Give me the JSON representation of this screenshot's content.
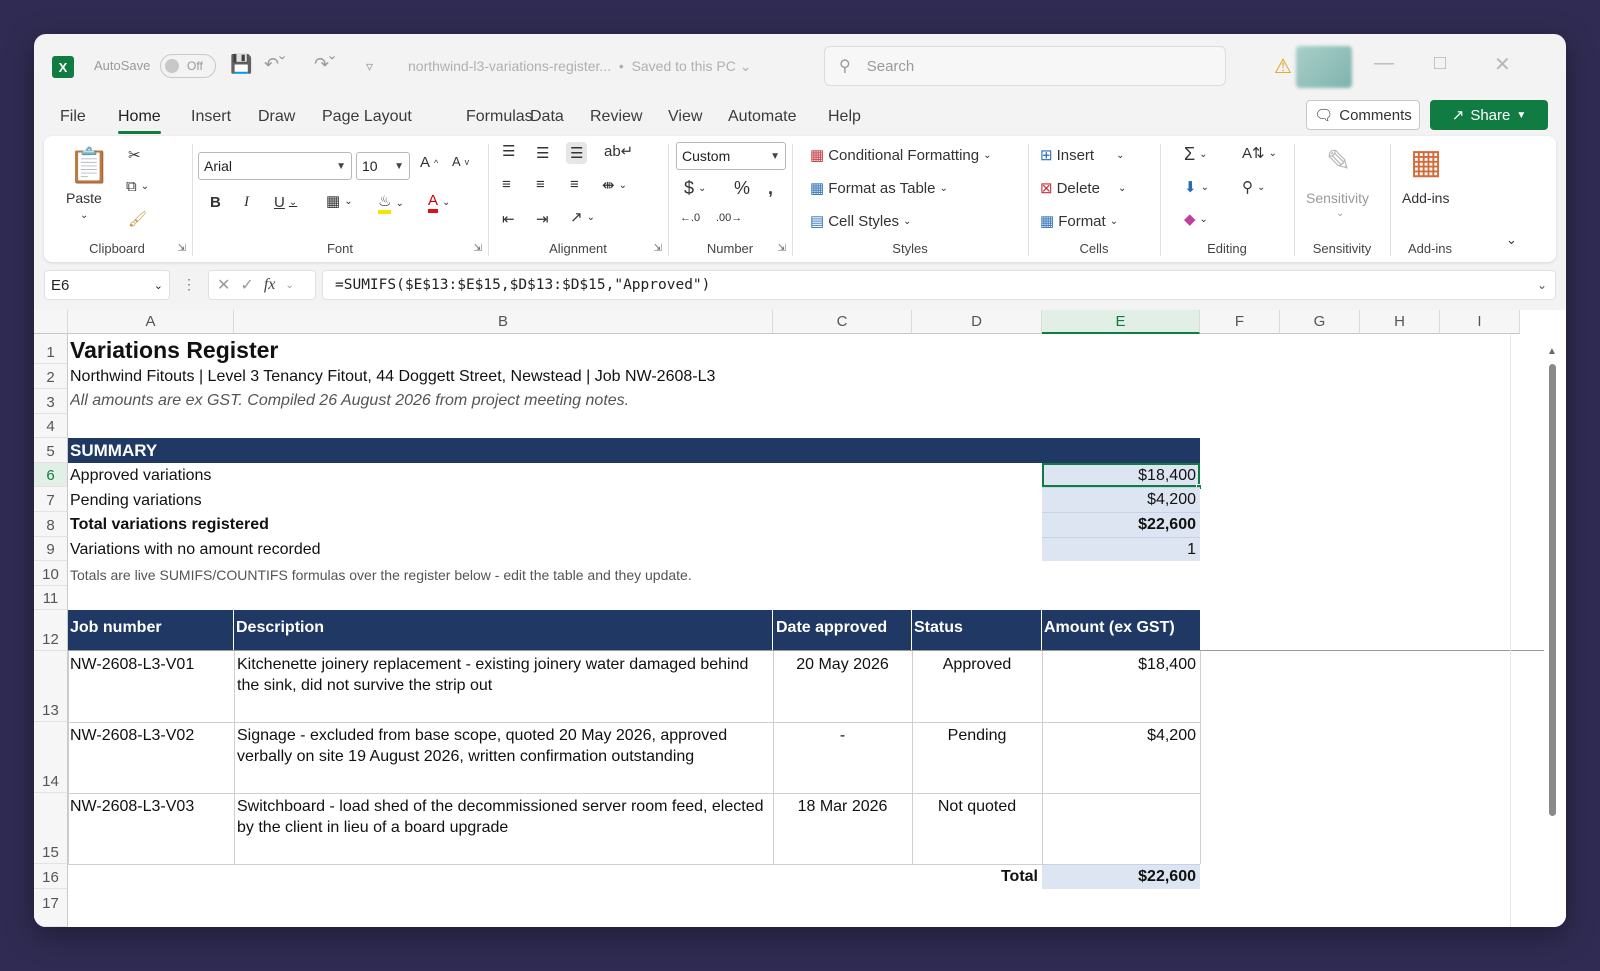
{
  "app": {
    "logo": "X",
    "autosave_label": "AutoSave",
    "autosave_state": "Off",
    "doc_title": "northwind-l3-variations-register...",
    "save_status": "Saved to this PC",
    "search_placeholder": "Search"
  },
  "menu": {
    "tabs": [
      "File",
      "Home",
      "Insert",
      "Draw",
      "Page Layout",
      "Formulas",
      "Data",
      "Review",
      "View",
      "Automate",
      "Help"
    ],
    "active": "Home",
    "comments_label": "Comments",
    "share_label": "Share"
  },
  "ribbon": {
    "clipboard": {
      "label": "Clipboard",
      "paste_label": "Paste"
    },
    "font": {
      "label": "Font",
      "font_name": "Arial",
      "font_size": "10"
    },
    "alignment": {
      "label": "Alignment"
    },
    "number": {
      "label": "Number",
      "format": "Custom"
    },
    "styles": {
      "label": "Styles",
      "conditional_formatting": "Conditional Formatting",
      "format_as_table": "Format as Table",
      "cell_styles": "Cell Styles"
    },
    "cells": {
      "label": "Cells",
      "insert": "Insert",
      "delete": "Delete",
      "format": "Format"
    },
    "editing": {
      "label": "Editing"
    },
    "sensitivity": {
      "label": "Sensitivity",
      "button": "Sensitivity"
    },
    "addins": {
      "label": "Add-ins",
      "button": "Add-ins"
    }
  },
  "formula_bar": {
    "name_box": "E6",
    "formula": "=SUMIFS($E$13:$E$15,$D$13:$D$15,\"Approved\")"
  },
  "columns": [
    "A",
    "B",
    "C",
    "D",
    "E",
    "F",
    "G",
    "H",
    "I"
  ],
  "rows": [
    "1",
    "2",
    "3",
    "4",
    "5",
    "6",
    "7",
    "8",
    "9",
    "10",
    "11",
    "12",
    "13",
    "14",
    "15",
    "16",
    "17"
  ],
  "sheet": {
    "title": "Variations Register",
    "subtitle": "Northwind Fitouts  |  Level 3 Tenancy Fitout, 44 Doggett Street, Newstead  |  Job NW-2608-L3",
    "note_gst": "All amounts are ex GST. Compiled 26 August 2026 from project meeting notes.",
    "summary_header": "SUMMARY",
    "summary": [
      {
        "label": "Approved variations",
        "value": "$18,400",
        "bold": false
      },
      {
        "label": "Pending variations",
        "value": "$4,200",
        "bold": false
      },
      {
        "label": "Total variations registered",
        "value": "$22,600",
        "bold": true
      },
      {
        "label": "Variations with no amount recorded",
        "value": "1",
        "bold": false
      }
    ],
    "summary_note": "Totals are live SUMIFS/COUNTIFS formulas over the register below - edit the table and they update.",
    "table_headers": [
      "Job number",
      "Description",
      "Date approved",
      "Status",
      "Amount (ex GST)"
    ],
    "table_rows": [
      {
        "job": "NW-2608-L3-V01",
        "description": "Kitchenette joinery replacement - existing joinery water damaged behind the sink, did not survive the strip out",
        "date": "20 May 2026",
        "status": "Approved",
        "amount": "$18,400"
      },
      {
        "job": "NW-2608-L3-V02",
        "description": "Signage - excluded from base scope, quoted 20 May 2026, approved verbally on site 19 August 2026, written confirmation outstanding",
        "date": "-",
        "status": "Pending",
        "amount": "$4,200"
      },
      {
        "job": "NW-2608-L3-V03",
        "description": "Switchboard - load shed of the decommissioned server room feed, elected by the client in lieu of a board upgrade",
        "date": "18 Mar 2026",
        "status": "Not quoted",
        "amount": ""
      }
    ],
    "total_label": "Total",
    "total_value": "$22,600"
  },
  "colors": {
    "excel_green": "#107c41",
    "header_navy": "#1f3864",
    "summary_fill": "#dde5f2"
  }
}
